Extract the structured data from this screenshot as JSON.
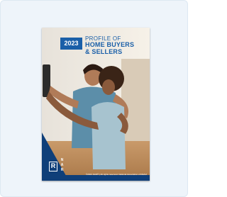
{
  "cover": {
    "year": "2023",
    "title_line_1": "PROFILE OF",
    "title_line_2": "HOME BUYERS",
    "title_line_3": "& SELLERS",
    "logo_mark": "R",
    "logo_letters": [
      "N",
      "A",
      "R"
    ],
    "footer_note": "©2023 NAR® | All rights reserved. National Association of REALTORS®"
  },
  "colors": {
    "background": "#eef4fa",
    "brand_blue": "#1a5fa8",
    "navy": "#0f3f79"
  }
}
